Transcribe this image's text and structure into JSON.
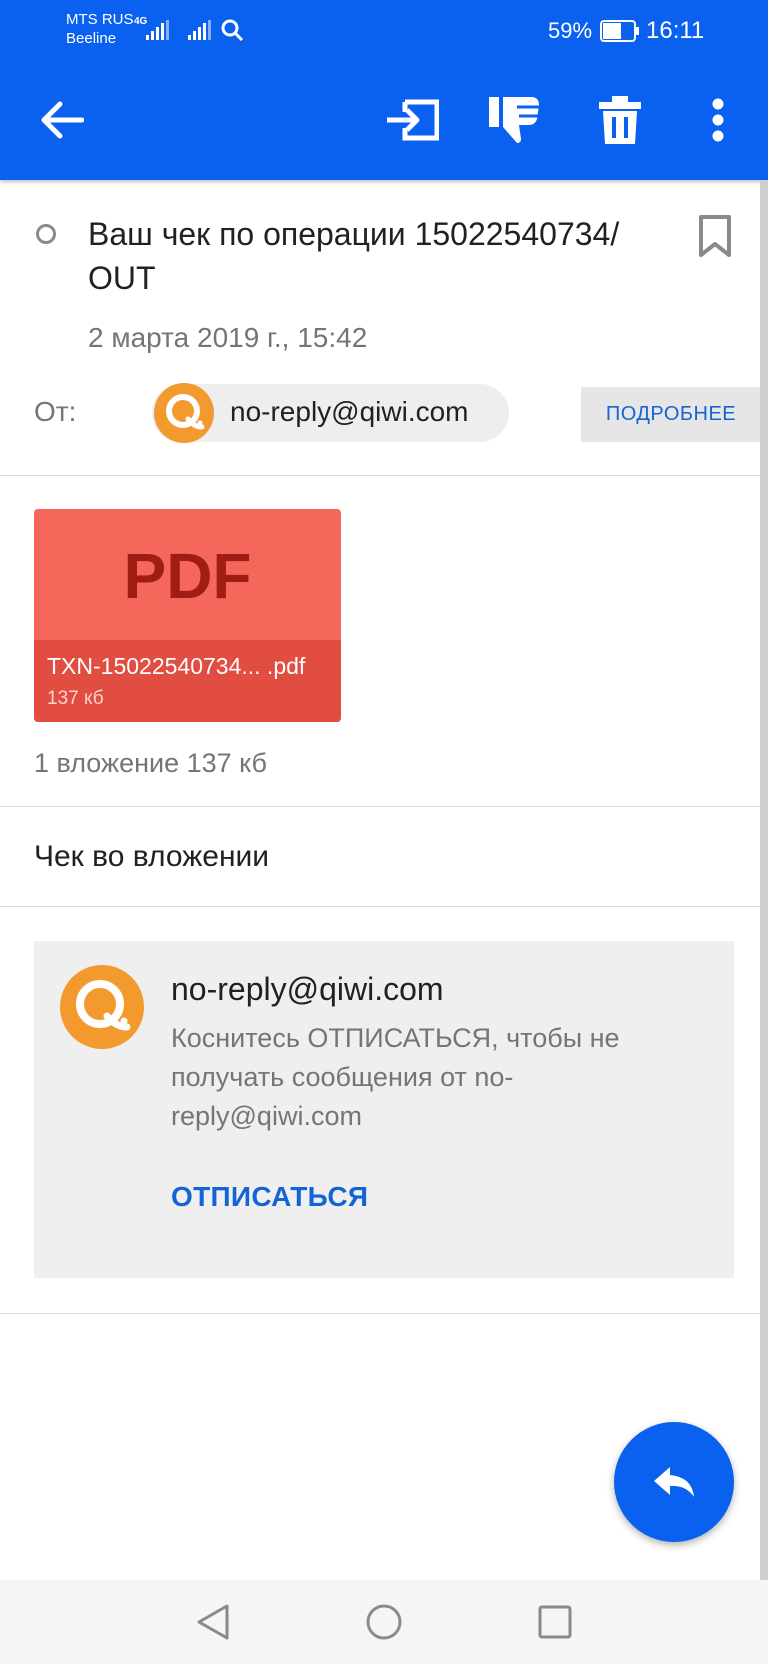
{
  "status_bar": {
    "carrier_1": "MTS RUS",
    "carrier_2": "Beeline",
    "network_type": "4G",
    "battery_percent": "59%",
    "time": "16:11"
  },
  "app_bar": {
    "icons": [
      "back-arrow-icon",
      "move-to-folder-icon",
      "thumbs-down-spam-icon",
      "trash-icon",
      "more-vert-icon"
    ],
    "color": "#0a61f0"
  },
  "message": {
    "subject": "Ваш чек по операции 15022540734/ OUT",
    "date": "2 марта 2019 г., 15:42",
    "from_label": "От:",
    "sender_email": "no-reply@qiwi.com",
    "details_button": "ПОДРОБНЕЕ",
    "body_text": "Чек во вложении"
  },
  "attachment": {
    "type_label": "PDF",
    "filename": "TXN-15022540734... .pdf",
    "size": "137 кб",
    "summary": "1 вложение 137 кб"
  },
  "unsubscribe": {
    "sender_email": "no-reply@qiwi.com",
    "description": "Коснитесь ОТПИСАТЬСЯ, чтобы не получать сообщения от no-reply@qiwi.com",
    "button_label": "ОТПИСАТЬСЯ"
  },
  "fab": {
    "icon": "reply-icon"
  },
  "nav_bar": {
    "icons": [
      "nav-back-icon",
      "nav-home-icon",
      "nav-recents-icon"
    ]
  },
  "colors": {
    "primary": "#0a61f0",
    "accent_text": "#1464d6",
    "pdf_tile": "#f4675a",
    "qiwi_orange": "#f39a2f"
  }
}
